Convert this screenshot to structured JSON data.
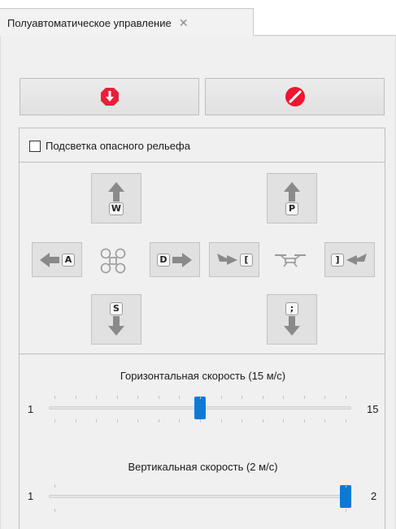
{
  "tab": {
    "title": "Полуавтоматическое управление",
    "close_icon": "close-icon"
  },
  "actions": {
    "stop_icon": "stop-hexagon-icon",
    "stop_color": "#e8203a",
    "cancel_icon": "cancel-circle-icon",
    "cancel_color": "#f2142f"
  },
  "terrain_highlight": {
    "label": "Подсветка опасного рельефа",
    "checked": false
  },
  "movement_keys": {
    "forward": "W",
    "left": "A",
    "right": "D",
    "back": "S",
    "center_icon": "drone-icon"
  },
  "altitude_keys": {
    "up": "P",
    "rotate_left": "[",
    "rotate_right": "]",
    "down": ";",
    "center_icon": "drone-side-icon"
  },
  "horizontal_speed": {
    "title": "Горизонтальная скорость (15 м/с)",
    "min": "1",
    "max": "15",
    "value": 8,
    "range": [
      1,
      15
    ]
  },
  "vertical_speed": {
    "title": "Вертикальная скорость (2 м/с)",
    "min": "1",
    "max": "2",
    "value": 2,
    "range": [
      1,
      2
    ]
  }
}
